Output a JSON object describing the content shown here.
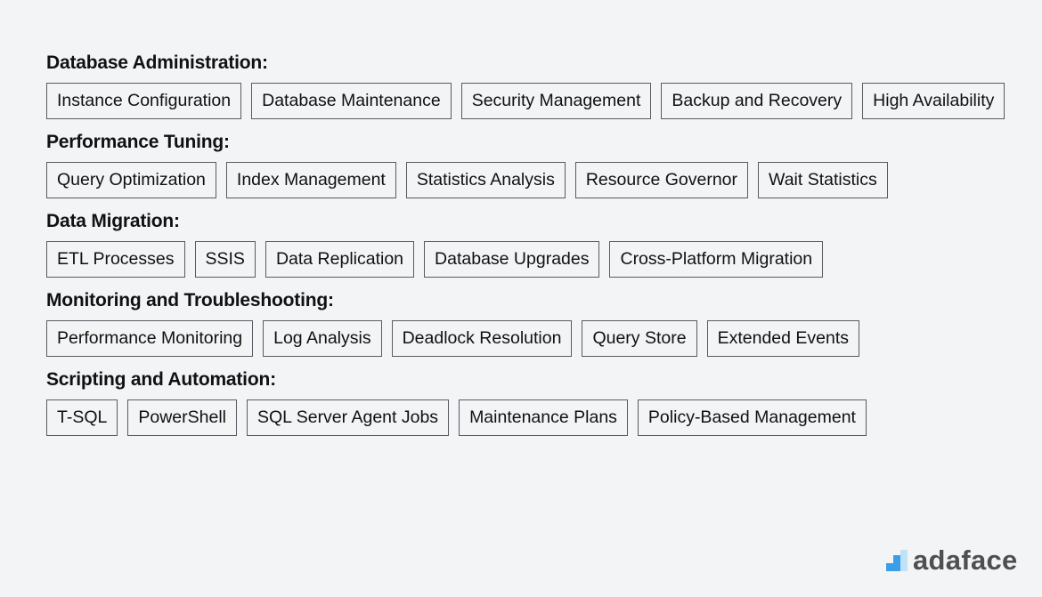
{
  "sections": [
    {
      "title": "Database Administration:",
      "tags": [
        "Instance Configuration",
        "Database Maintenance",
        "Security Management",
        "Backup and Recovery",
        "High Availability"
      ]
    },
    {
      "title": "Performance Tuning:",
      "tags": [
        "Query Optimization",
        "Index Management",
        "Statistics Analysis",
        "Resource Governor",
        "Wait Statistics"
      ]
    },
    {
      "title": "Data Migration:",
      "tags": [
        "ETL Processes",
        "SSIS",
        "Data Replication",
        "Database Upgrades",
        "Cross-Platform Migration"
      ]
    },
    {
      "title": "Monitoring and Troubleshooting:",
      "tags": [
        "Performance Monitoring",
        "Log Analysis",
        "Deadlock Resolution",
        "Query Store",
        "Extended Events"
      ]
    },
    {
      "title": "Scripting and Automation:",
      "tags": [
        "T-SQL",
        "PowerShell",
        "SQL Server Agent Jobs",
        "Maintenance Plans",
        "Policy-Based Management"
      ]
    }
  ],
  "logo": {
    "text": "adaface",
    "icon": "bar-steps-icon",
    "colors": {
      "primary": "#3a9ee8",
      "light": "#bfe2f8",
      "text": "#4f4f53"
    }
  }
}
